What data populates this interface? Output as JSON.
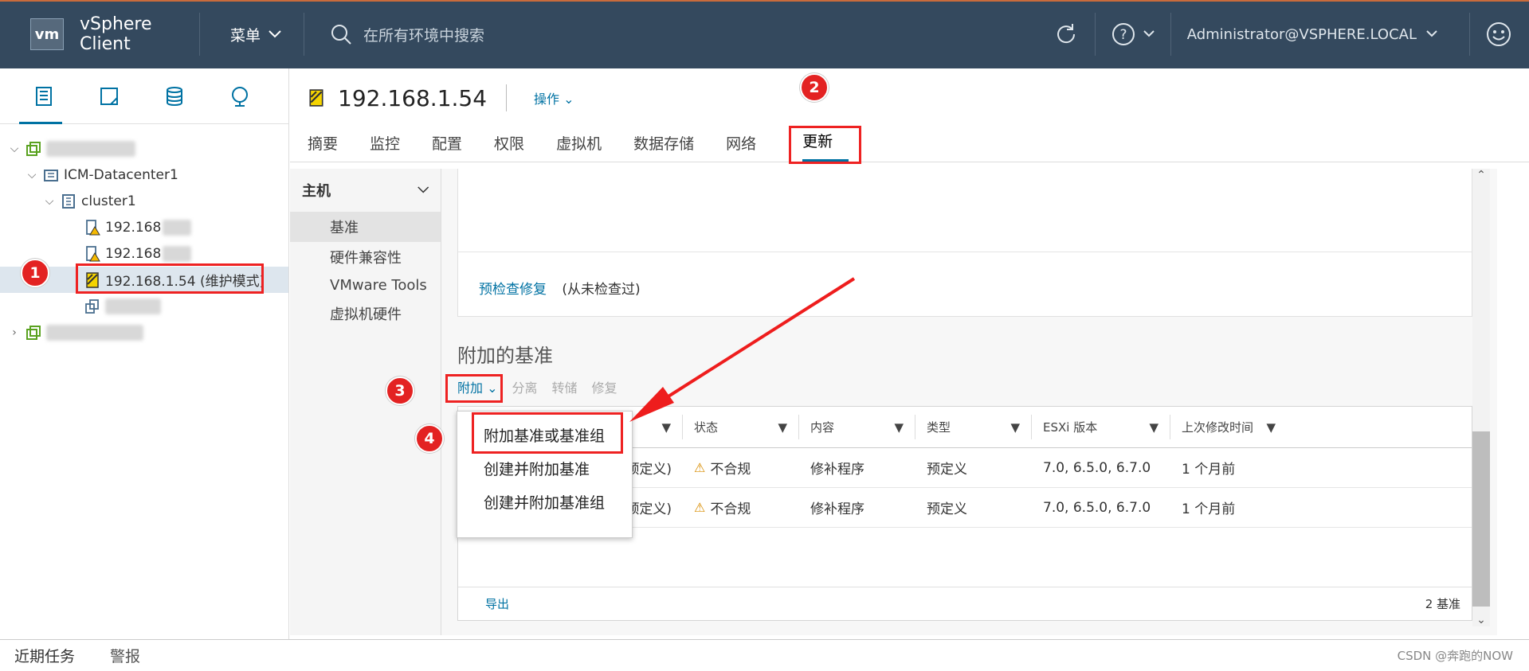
{
  "header": {
    "logo": "vm",
    "app_title": "vSphere Client",
    "menu_label": "菜单",
    "search_placeholder": "在所有环境中搜索",
    "user": "Administrator@VSPHERE.LOCAL"
  },
  "tree": {
    "datacenter": "ICM-Datacenter1",
    "cluster": "cluster1",
    "host1": "192.168",
    "host2": "192.168",
    "host3": "192.168.1.54 (维护模式)"
  },
  "main": {
    "title": "192.168.1.54",
    "ops_label": "操作",
    "tabs": [
      "摘要",
      "监控",
      "配置",
      "权限",
      "虚拟机",
      "数据存储",
      "网络",
      "更新"
    ]
  },
  "subnav": {
    "head": "主机",
    "items": [
      "基准",
      "硬件兼容性",
      "VMware Tools",
      "虚拟机硬件"
    ]
  },
  "content": {
    "precheck_link": "预检查修复",
    "precheck_status": "(从未检查过)",
    "section_title": "附加的基准",
    "actions": [
      "附加",
      "分离",
      "转储",
      "修复"
    ],
    "columns": [
      "状态",
      "内容",
      "类型",
      "ESXi 版本",
      "上次修改时间"
    ],
    "rows": [
      {
        "name": "预定义)",
        "status": "不合规",
        "content": "修补程序",
        "type": "预定义",
        "esxi": "7.0, 6.5.0, 6.7.0",
        "modified": "1 个月前"
      },
      {
        "name": "预定义)",
        "status": "不合规",
        "content": "修补程序",
        "type": "预定义",
        "esxi": "7.0, 6.5.0, 6.7.0",
        "modified": "1 个月前"
      }
    ],
    "export": "导出",
    "count": "2 基准"
  },
  "dropdown": [
    "附加基准或基准组",
    "创建并附加基准",
    "创建并附加基准组"
  ],
  "badges": [
    "1",
    "2",
    "3",
    "4"
  ],
  "bottom": {
    "tasks": "近期任务",
    "alarms": "警报",
    "watermark": "CSDN @奔跑的NOW"
  },
  "colors": {
    "header_bg": "#34495e",
    "accent": "#0072a3",
    "highlight": "#e22222"
  }
}
